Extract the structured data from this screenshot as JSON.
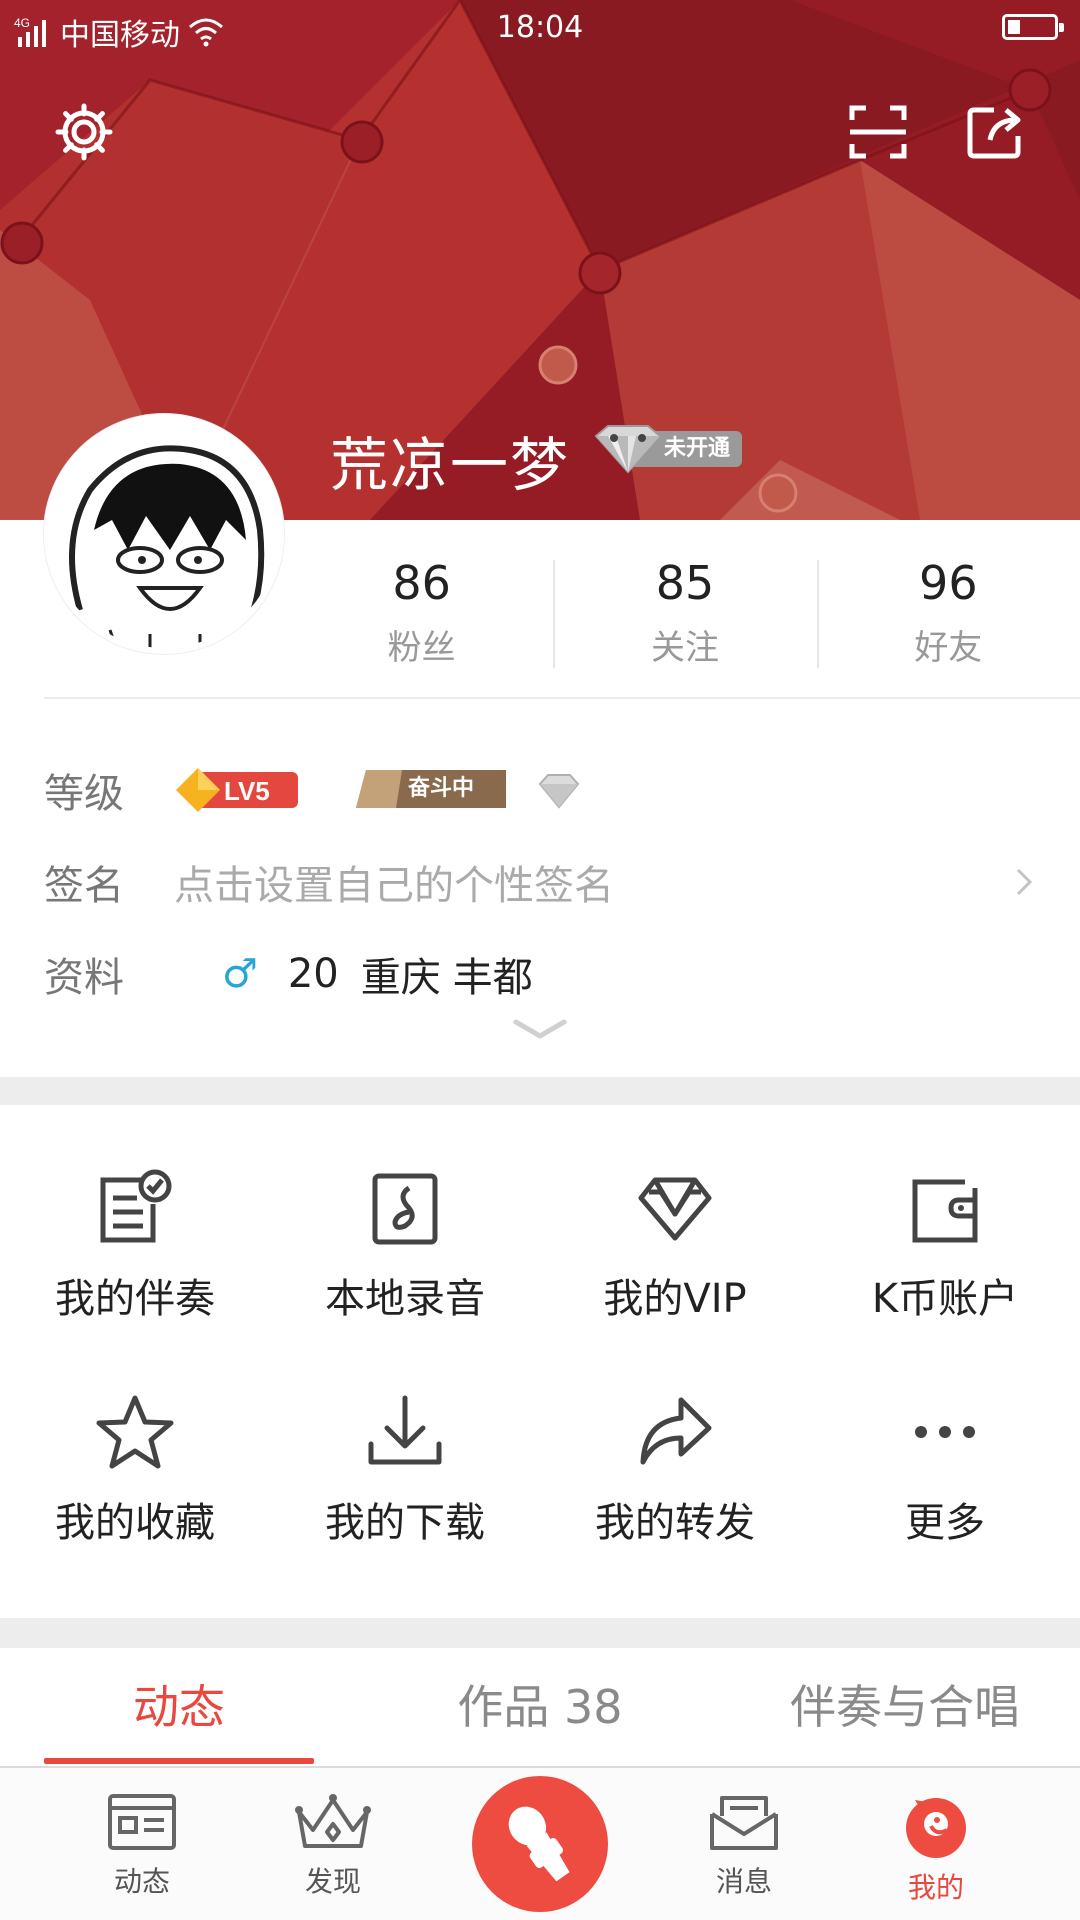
{
  "status_bar": {
    "network": "4G",
    "carrier": "中国移动",
    "time": "18:04"
  },
  "header": {
    "username": "荒凉一梦",
    "vip_status": "未开通"
  },
  "stats": [
    {
      "value": "86",
      "label": "粉丝"
    },
    {
      "value": "85",
      "label": "关注"
    },
    {
      "value": "96",
      "label": "好友"
    }
  ],
  "info": {
    "level_key": "等级",
    "level_badge": "LV5",
    "level_status": "奋斗中",
    "sign_key": "签名",
    "sign_placeholder": "点击设置自己的个性签名",
    "profile_key": "资料",
    "gender_symbol": "♂",
    "age": "20",
    "city": "重庆",
    "district": "丰都"
  },
  "grid": [
    {
      "label": "我的伴奏",
      "icon": "accompaniment-icon"
    },
    {
      "label": "本地录音",
      "icon": "local-recording-icon"
    },
    {
      "label": "我的VIP",
      "icon": "vip-diamond-icon"
    },
    {
      "label": "K币账户",
      "icon": "wallet-icon"
    },
    {
      "label": "我的收藏",
      "icon": "star-icon"
    },
    {
      "label": "我的下载",
      "icon": "download-icon"
    },
    {
      "label": "我的转发",
      "icon": "share-arrow-icon"
    },
    {
      "label": "更多",
      "icon": "more-icon"
    }
  ],
  "tabs": [
    {
      "label": "动态",
      "active": true
    },
    {
      "label": "作品 38",
      "active": false
    },
    {
      "label": "伴奏与合唱",
      "active": false
    }
  ],
  "bottom_nav": [
    {
      "label": "动态",
      "icon": "feed-icon"
    },
    {
      "label": "发现",
      "icon": "crown-icon"
    },
    {
      "label": "消息",
      "icon": "message-icon"
    },
    {
      "label": "我的",
      "icon": "me-icon",
      "active": true
    }
  ],
  "colors": {
    "accent": "#e8483d",
    "banner": "#8e1b22",
    "page_background": "#ffffff",
    "separator": "#ededed"
  }
}
